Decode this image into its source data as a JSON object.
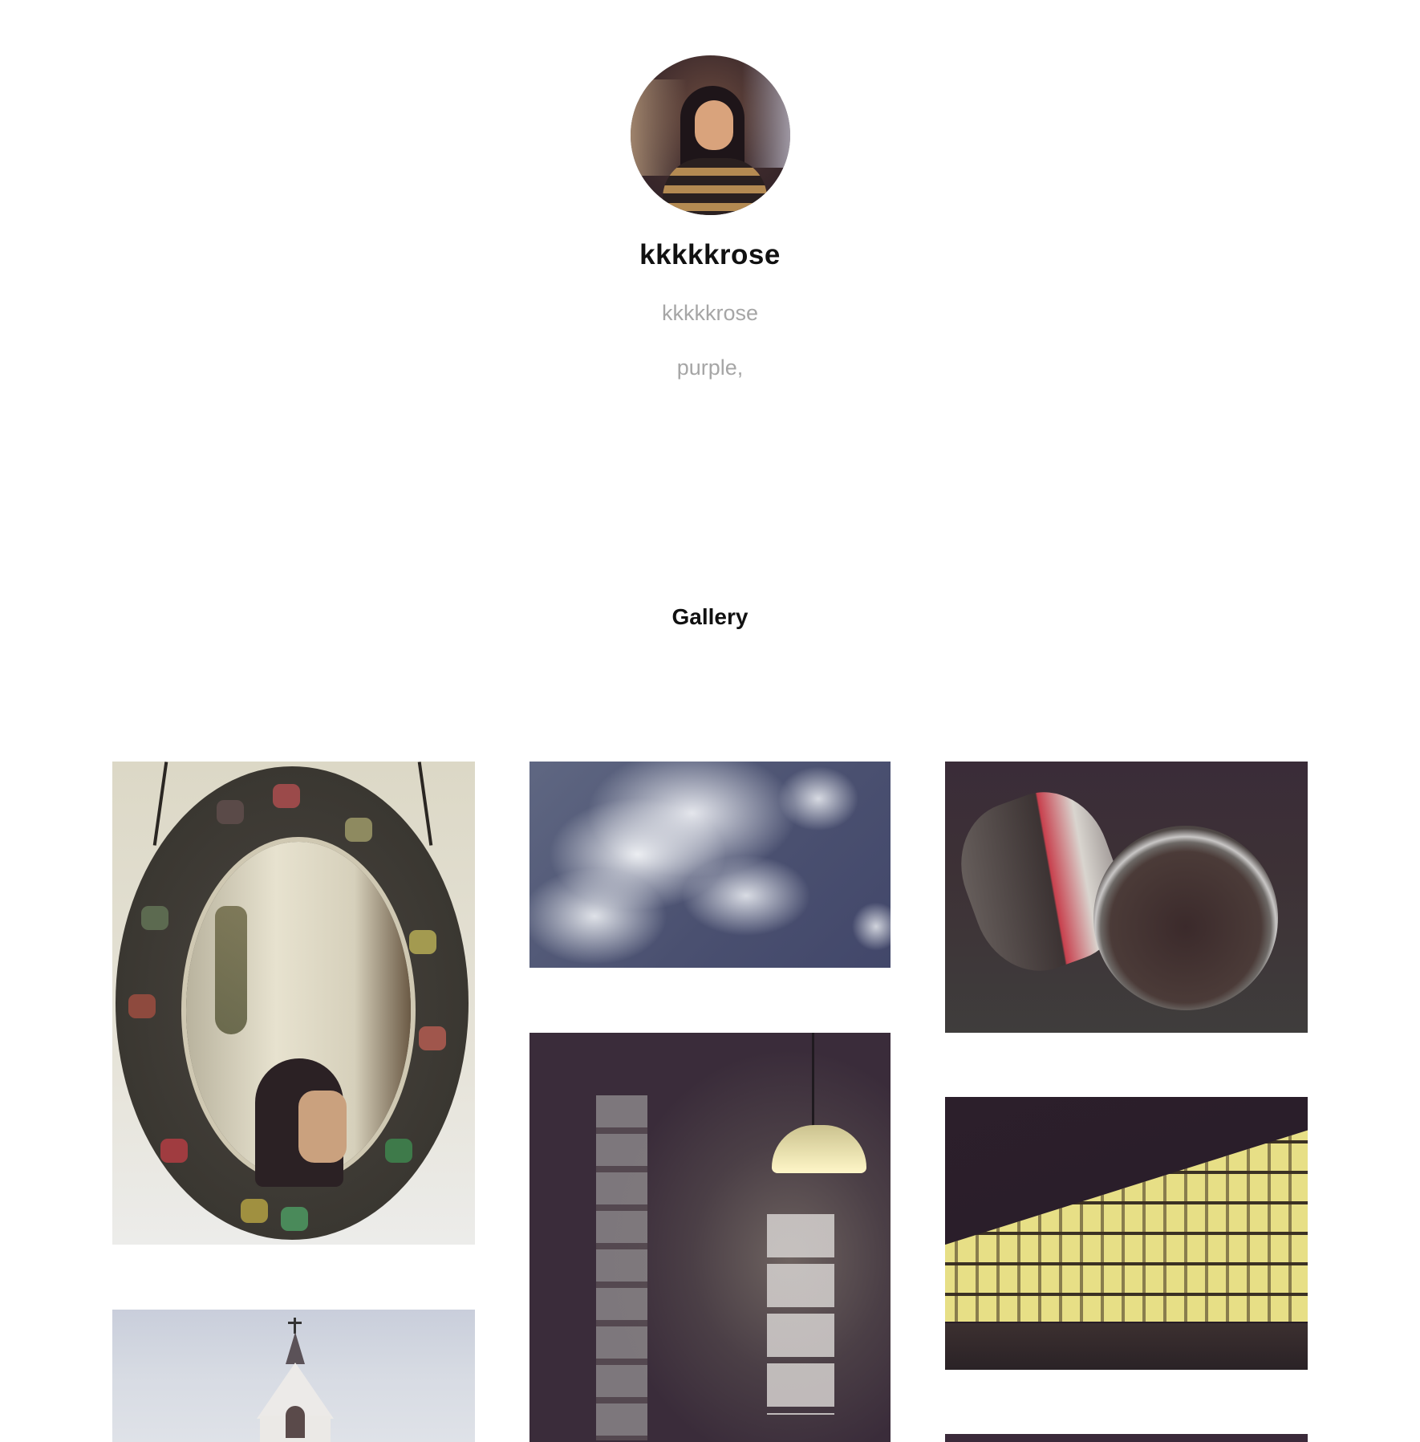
{
  "profile": {
    "display_name": "kkkkkrose",
    "username": "kkkkkrose",
    "bio": "purple,"
  },
  "gallery": {
    "title": "Gallery",
    "photos": [
      {
        "subject": "jeweled oval mirror selfie"
      },
      {
        "subject": "clouds in blue sky"
      },
      {
        "subject": "two metal buckets on pavement"
      },
      {
        "subject": "hanging lamp over wall with stickers and photos"
      },
      {
        "subject": "rows of yellow paper lanterns at night"
      },
      {
        "subject": "white church tower against sky"
      },
      {
        "subject": "dark photo"
      }
    ]
  },
  "colors": {
    "background": "#ffffff",
    "name_text": "#111111",
    "muted_text": "#a6a6a6"
  }
}
